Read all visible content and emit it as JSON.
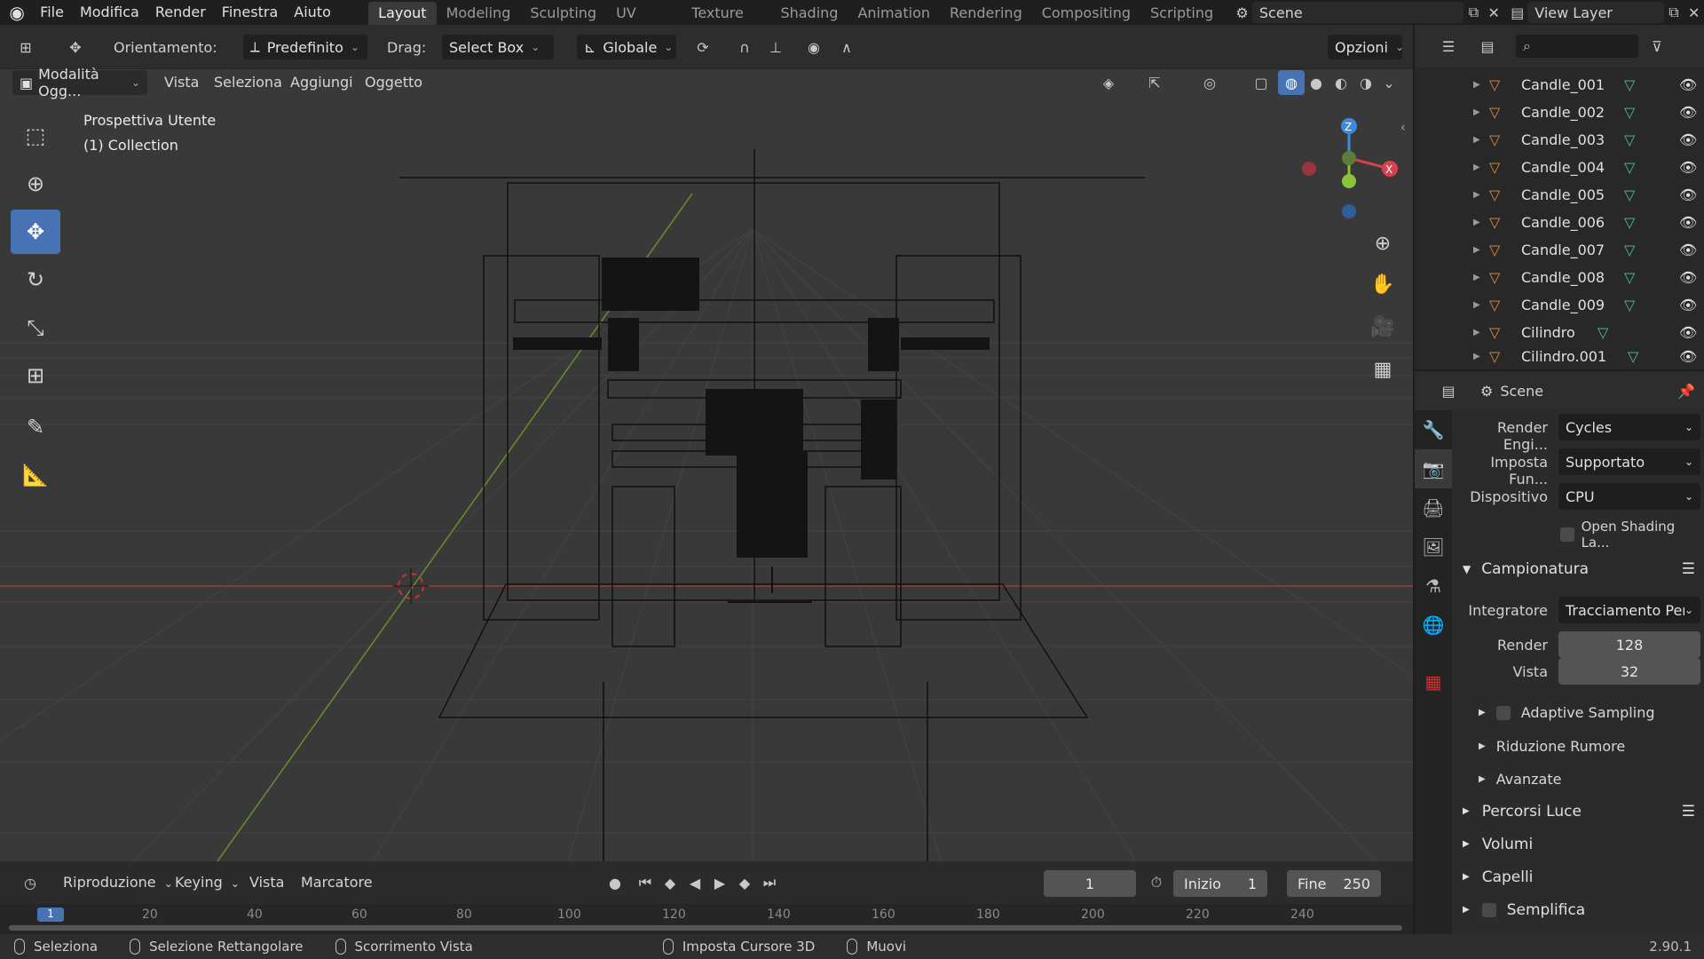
{
  "menubar": {
    "items": [
      "File",
      "Modifica",
      "Render",
      "Finestra",
      "Aiuto"
    ],
    "workspaces": [
      "Layout",
      "Modeling",
      "Sculpting",
      "UV Editing",
      "Texture Paint",
      "Shading",
      "Animation",
      "Rendering",
      "Compositing",
      "Scripting"
    ],
    "active_workspace": "Layout",
    "scene": "Scene",
    "view_layer": "View Layer"
  },
  "toolheader": {
    "orientation_label": "Orientamento:",
    "orientation_value": "Predefinito",
    "drag_label": "Drag:",
    "drag_value": "Select Box",
    "transform_value": "Globale",
    "options_label": "Opzioni"
  },
  "viewheader": {
    "mode": "Modalità Ogg...",
    "items": [
      "Vista",
      "Seleziona",
      "Aggiungi",
      "Oggetto"
    ]
  },
  "viewport": {
    "view_name": "Prospettiva Utente",
    "collection": "(1) Collection"
  },
  "outliner": {
    "rows": [
      "Candle_001",
      "Candle_002",
      "Candle_003",
      "Candle_004",
      "Candle_005",
      "Candle_006",
      "Candle_007",
      "Candle_008",
      "Candle_009",
      "Cilindro",
      "Cilindro.001"
    ]
  },
  "properties": {
    "context": "Scene",
    "render_engine_label": "Render Engi...",
    "render_engine_value": "Cycles",
    "feature_set_label": "Imposta Fun...",
    "feature_set_value": "Supportato",
    "device_label": "Dispositivo",
    "device_value": "CPU",
    "osl_label": "Open Shading La...",
    "sampling_panel": "Campionatura",
    "integrator_label": "Integratore",
    "integrator_value": "Tracciamento Per...",
    "render_label": "Render",
    "render_value": "128",
    "viewport_label": "Vista",
    "viewport_value": "32",
    "adaptive_sampling": "Adaptive Sampling",
    "denoising": "Riduzione Rumore",
    "advanced": "Avanzate",
    "light_paths": "Percorsi Luce",
    "volumes": "Volumi",
    "hair": "Capelli",
    "simplify": "Semplifica"
  },
  "timeline": {
    "menus": [
      "Riproduzione",
      "Keying",
      "Vista",
      "Marcatore"
    ],
    "current_frame": "1",
    "start_label": "Inizio",
    "start_value": "1",
    "end_label": "Fine",
    "end_value": "250",
    "ruler": [
      "1",
      "20",
      "40",
      "60",
      "80",
      "100",
      "120",
      "140",
      "160",
      "180",
      "200",
      "220",
      "240"
    ]
  },
  "statusbar": {
    "items": [
      "Seleziona",
      "Selezione Rettangolare",
      "Scorrimento Vista",
      "Imposta Cursore 3D",
      "Muovi"
    ],
    "version": "2.90.1"
  },
  "colors": {
    "accent": "#4772b3",
    "axis_x": "#d9404d",
    "axis_y": "#8ac43a",
    "axis_z": "#3a8be0",
    "mesh_icon": "#e38c3e",
    "data_icon": "#4fc28c"
  }
}
